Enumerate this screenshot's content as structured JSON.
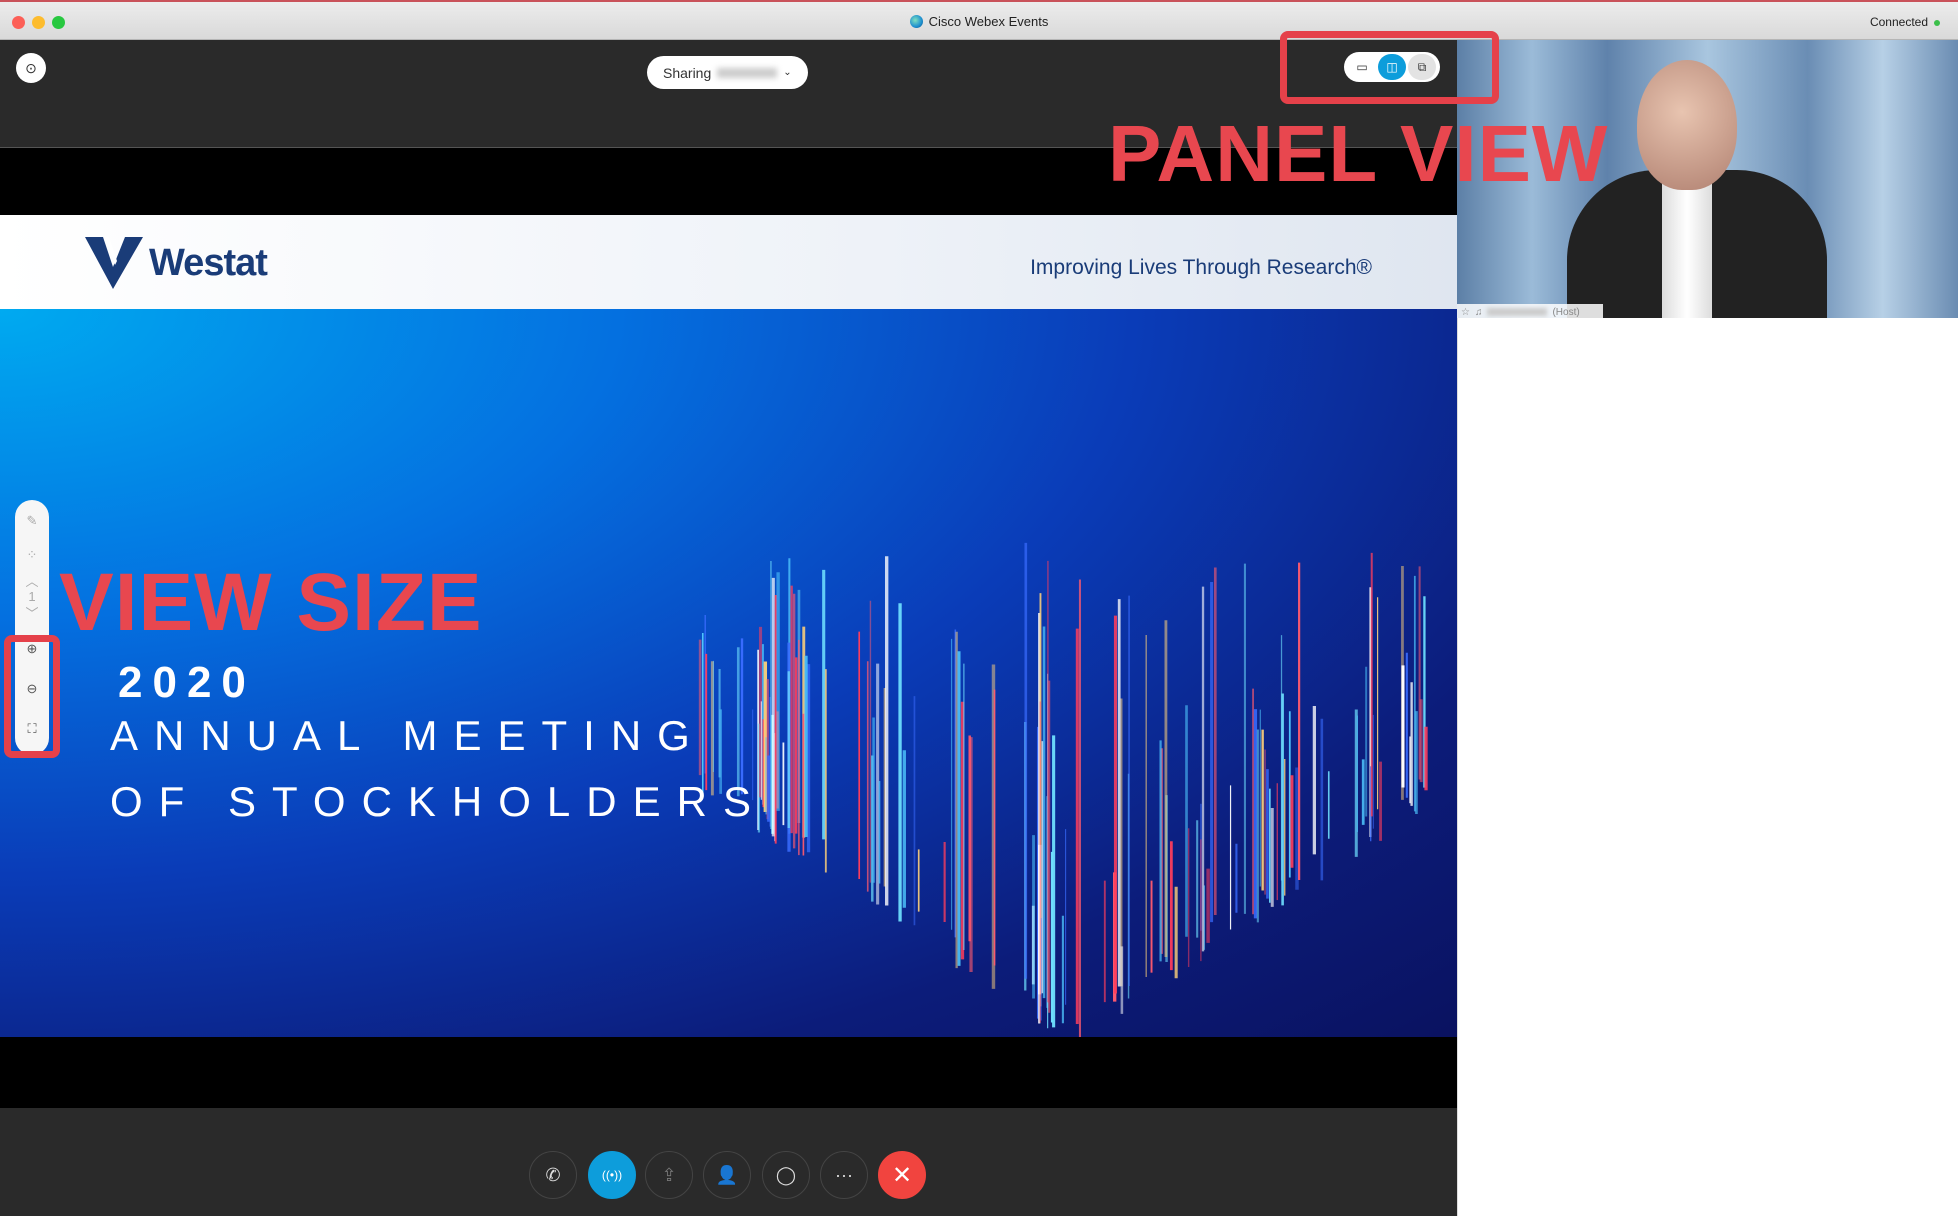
{
  "window": {
    "title": "Cisco Webex Events",
    "status": "Connected",
    "status_color": "#3bbf4a"
  },
  "top": {
    "sharing_label": "Sharing",
    "layouts": [
      {
        "name": "stage-view-icon",
        "active": false
      },
      {
        "name": "panel-view-icon",
        "active": true
      },
      {
        "name": "floating-view-icon",
        "active": false
      }
    ]
  },
  "slide": {
    "brand": "Westat",
    "tagline": "Improving Lives Through Research®",
    "year": "2020",
    "line1": "ANNUAL MEETING",
    "line2": "OF STOCKHOLDERS"
  },
  "toolbar": {
    "page": "1"
  },
  "annotations": {
    "panel_view": "PANEL VIEW",
    "view_size": "VIEW SIZE",
    "color": "#e5414a"
  },
  "video": {
    "host_suffix": "(Host)"
  },
  "controls": [
    {
      "name": "audio-button",
      "icon": "phone-icon",
      "glyph": "✆"
    },
    {
      "name": "broadcast-button",
      "icon": "broadcast-icon",
      "glyph": "((•))"
    },
    {
      "name": "share-button",
      "icon": "share-icon",
      "glyph": "⇪"
    },
    {
      "name": "participants-button",
      "icon": "participants-icon",
      "glyph": "👤"
    },
    {
      "name": "chat-button",
      "icon": "chat-icon",
      "glyph": "◯"
    },
    {
      "name": "more-button",
      "icon": "more-icon",
      "glyph": "···"
    },
    {
      "name": "leave-button",
      "icon": "close-icon",
      "glyph": "✕"
    }
  ],
  "colors": {
    "accent": "#0d9ddb",
    "leave": "#f1443f",
    "brand": "#1a3c78"
  }
}
